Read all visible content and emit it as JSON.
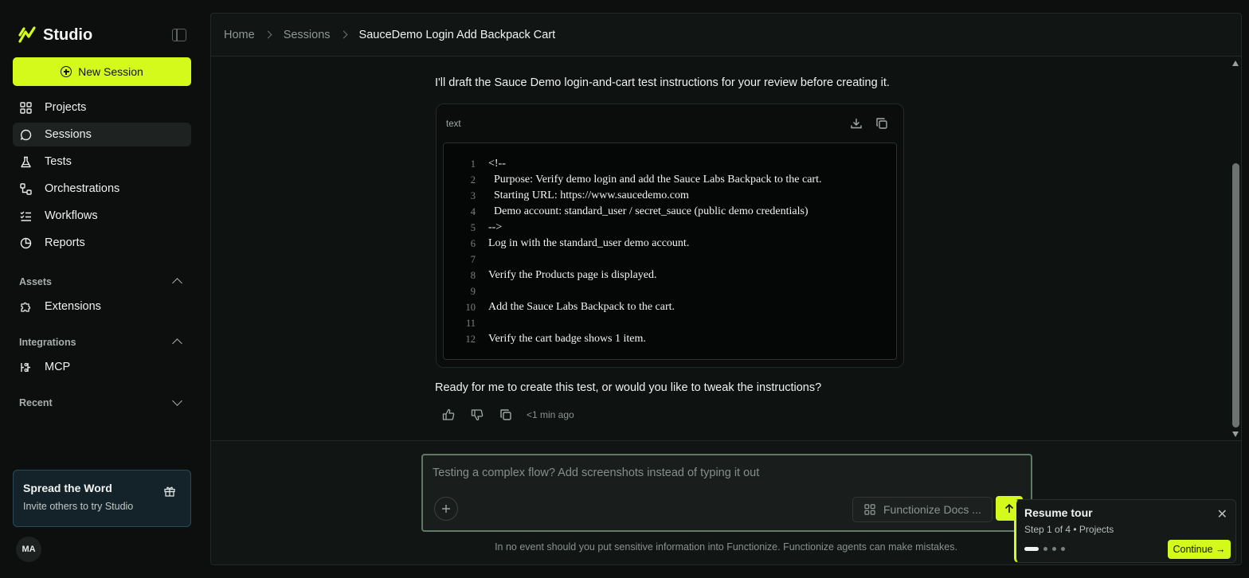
{
  "app": {
    "name": "Studio"
  },
  "sidebar": {
    "new_session_label": "New Session",
    "nav": [
      {
        "label": "Projects",
        "icon": "grid-icon"
      },
      {
        "label": "Sessions",
        "icon": "chat-bubble-icon",
        "active": true
      },
      {
        "label": "Tests",
        "icon": "flask-icon"
      },
      {
        "label": "Orchestrations",
        "icon": "orchestration-icon"
      },
      {
        "label": "Workflows",
        "icon": "checklist-icon"
      },
      {
        "label": "Reports",
        "icon": "pie-chart-icon"
      }
    ],
    "sections": {
      "assets": {
        "label": "Assets",
        "expanded": true,
        "items": [
          {
            "label": "Extensions",
            "icon": "puzzle-icon"
          }
        ]
      },
      "integrations": {
        "label": "Integrations",
        "expanded": true,
        "items": [
          {
            "label": "MCP",
            "icon": "mcp-icon"
          }
        ]
      },
      "recent": {
        "label": "Recent",
        "expanded": false
      }
    },
    "promo": {
      "title": "Spread the Word",
      "subtitle": "Invite others to try Studio"
    },
    "avatar_initials": "MA"
  },
  "breadcrumb": {
    "items": [
      "Home",
      "Sessions",
      "SauceDemo Login Add Backpack Cart"
    ]
  },
  "chat": {
    "intro_message": "I'll draft the Sauce Demo login-and-cart test instructions for your review before creating it.",
    "code_block": {
      "language": "text",
      "lines": [
        {
          "n": "1",
          "text": "<!--"
        },
        {
          "n": "2",
          "text": "  Purpose: Verify demo login and add the Sauce Labs Backpack to the cart."
        },
        {
          "n": "3",
          "text": "  Starting URL: https://www.saucedemo.com"
        },
        {
          "n": "4",
          "text": "  Demo account: standard_user / secret_sauce (public demo credentials)"
        },
        {
          "n": "5",
          "text": "-->"
        },
        {
          "n": "6",
          "text": "Log in with the standard_user demo account."
        },
        {
          "n": "7",
          "text": ""
        },
        {
          "n": "8",
          "text": "Verify the Products page is displayed."
        },
        {
          "n": "9",
          "text": ""
        },
        {
          "n": "10",
          "text": "Add the Sauce Labs Backpack to the cart."
        },
        {
          "n": "11",
          "text": ""
        },
        {
          "n": "12",
          "text": "Verify the cart badge shows 1 item."
        }
      ]
    },
    "outro_message": "Ready for me to create this test, or would you like to tweak the instructions?",
    "timestamp": "<1 min ago"
  },
  "composer": {
    "placeholder": "Testing a complex flow? Add screenshots instead of typing it out",
    "docs_chip_label": "Functionize Docs ...",
    "disclaimer": "In no event should you put sensitive information into Functionize. Functionize agents can make mistakes."
  },
  "tour": {
    "title": "Resume tour",
    "subtitle": "Step 1 of 4 • Projects",
    "continue_label": "Continue →",
    "current_step": 1,
    "total_steps": 4
  },
  "colors": {
    "accent": "#d4fa1c",
    "background": "#0c0f0e",
    "panel": "#111514"
  }
}
